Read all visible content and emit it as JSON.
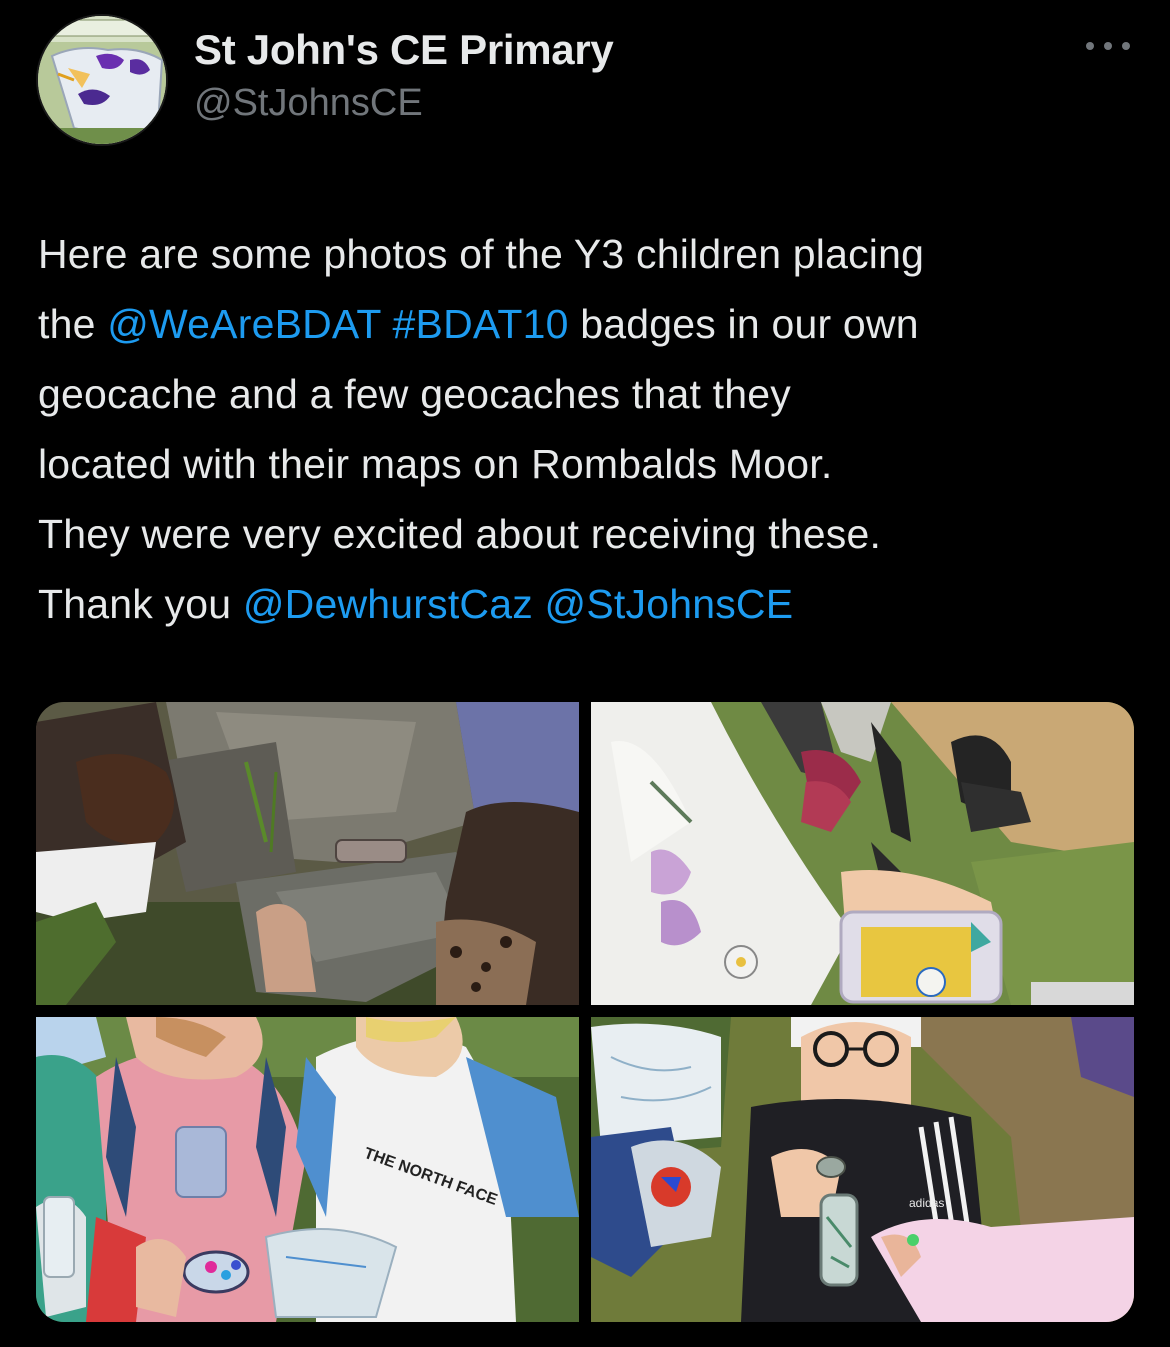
{
  "account": {
    "display_name": "St John's CE Primary",
    "handle": "@StJohnsCE"
  },
  "menu": {
    "icon": "more-horizontal-icon"
  },
  "tweet": {
    "line1": "Here are some photos of the Y3 children placing",
    "line2_pre": "the ",
    "mention_bdat": "@WeAreBDAT",
    "hashtag": "#BDAT10",
    "line2_post": " badges in our own",
    "line3": "geocache and a few geocaches that they",
    "line4": "located with their maps on Rombalds Moor.",
    "line5": "They were very excited about receiving these.",
    "line6_pre": "Thank you ",
    "mention_caz": "@DewhurstCaz",
    "mention_self": "@StJohnsCE"
  },
  "photos": [
    {
      "id": "photo-1"
    },
    {
      "id": "photo-2"
    },
    {
      "id": "photo-3",
      "shirt_text": "THE NORTH FACE"
    },
    {
      "id": "photo-4",
      "brand_text": "adidas"
    }
  ],
  "colors": {
    "background": "#000000",
    "text": "#e7e9ea",
    "secondary": "#71767b",
    "link": "#1d9bf0"
  }
}
